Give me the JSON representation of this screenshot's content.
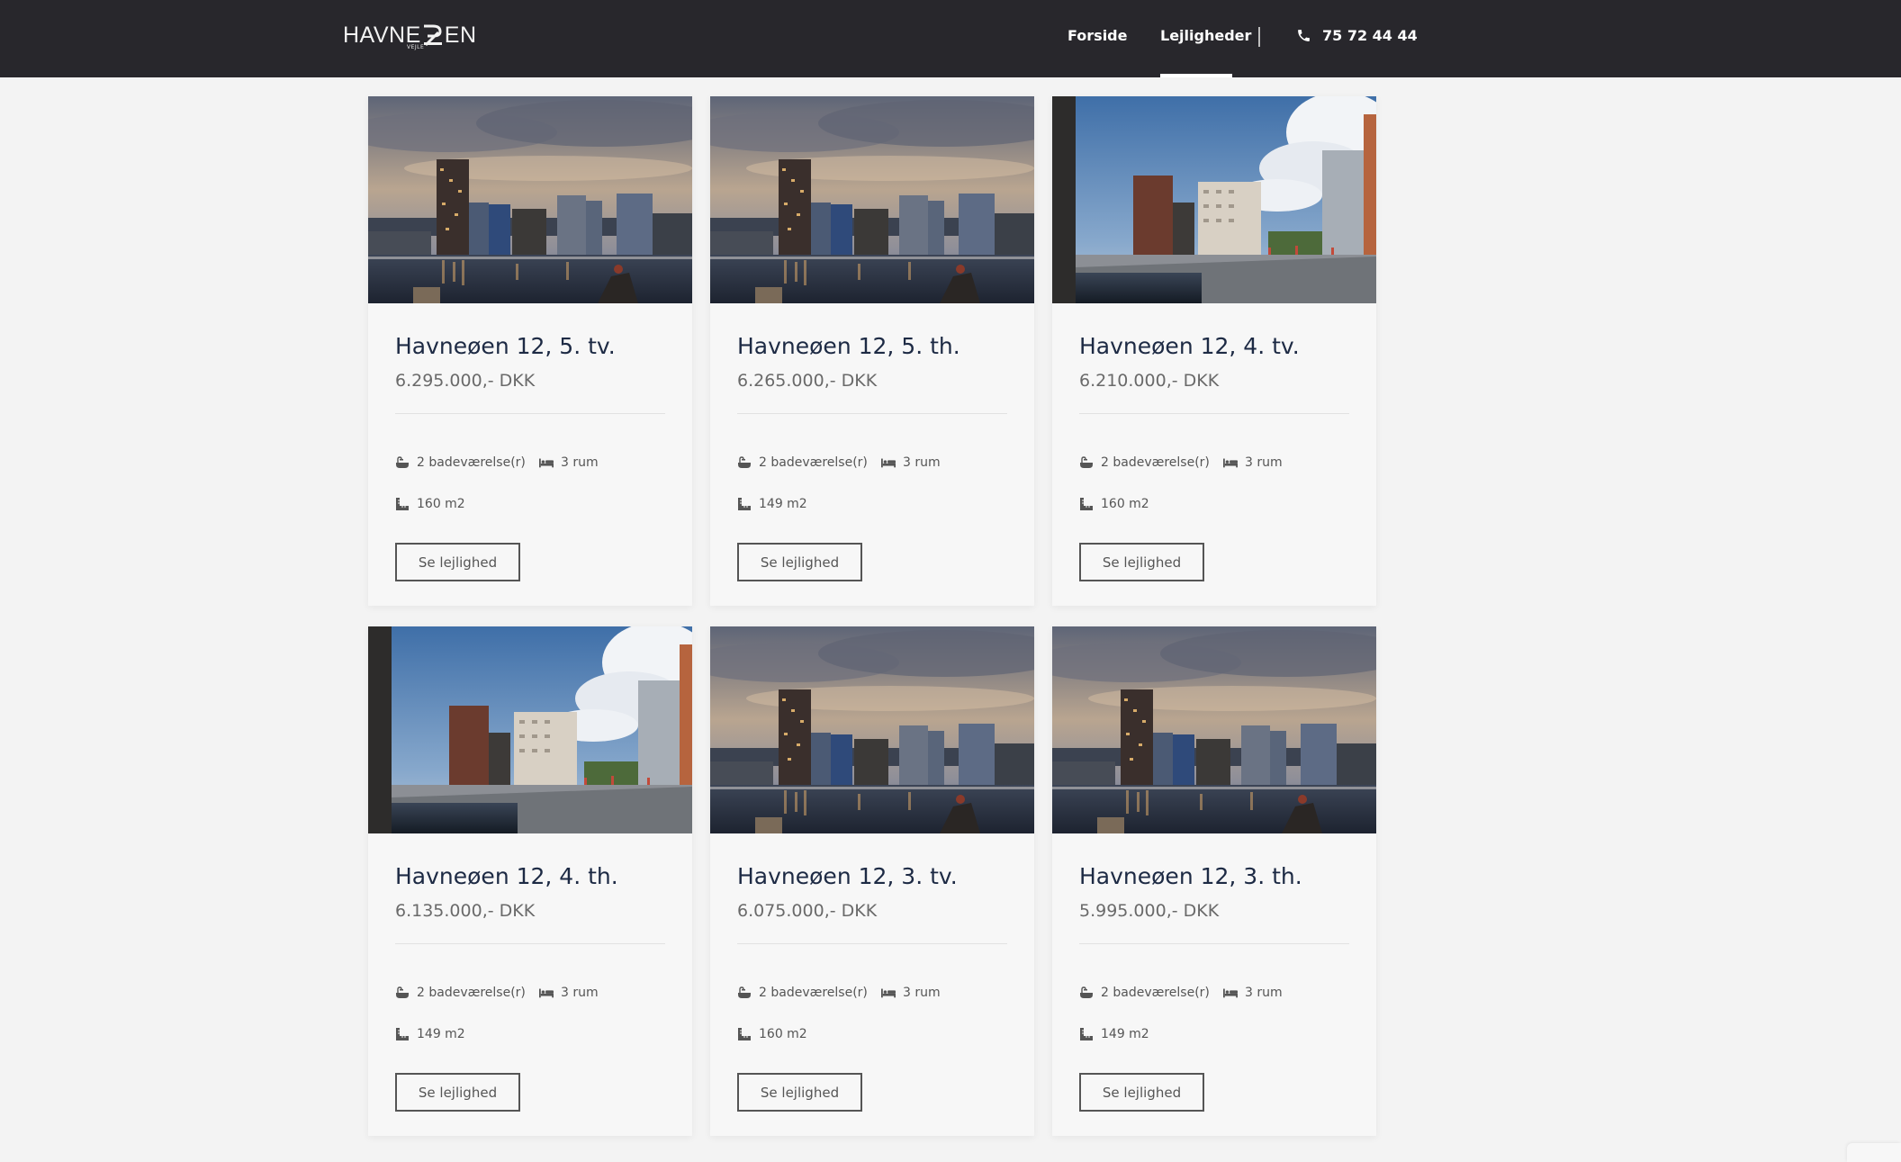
{
  "header": {
    "logo_text_left": "HAVNE",
    "logo_text_right": "EN",
    "logo_sub": "VEJLE",
    "nav": [
      {
        "label": "Forside",
        "active": false
      },
      {
        "label": "Lejligheder",
        "active": true
      }
    ],
    "phone": "75 72 44 44",
    "phone_icon": "phone-icon"
  },
  "colors": {
    "header_bg": "#28272c",
    "page_bg": "#f3f3f3",
    "card_bg": "#f7f7f7",
    "title": "#1d2a44",
    "text": "#555555"
  },
  "listings": [
    {
      "title": "Havneøen 12, 5. tv.",
      "price": "6.295.000,- DKK",
      "baths": "2 badeværelse(r)",
      "rooms": "3 rum",
      "area": "160 m2",
      "button": "Se lejlighed",
      "image": "dusk"
    },
    {
      "title": "Havneøen 12, 5. th.",
      "price": "6.265.000,- DKK",
      "baths": "2 badeværelse(r)",
      "rooms": "3 rum",
      "area": "149 m2",
      "button": "Se lejlighed",
      "image": "dusk"
    },
    {
      "title": "Havneøen 12, 4. tv.",
      "price": "6.210.000,- DKK",
      "baths": "2 badeværelse(r)",
      "rooms": "3 rum",
      "area": "160 m2",
      "button": "Se lejlighed",
      "image": "day"
    },
    {
      "title": "Havneøen 12, 4. th.",
      "price": "6.135.000,- DKK",
      "baths": "2 badeværelse(r)",
      "rooms": "3 rum",
      "area": "149 m2",
      "button": "Se lejlighed",
      "image": "day"
    },
    {
      "title": "Havneøen 12, 3. tv.",
      "price": "6.075.000,- DKK",
      "baths": "2 badeværelse(r)",
      "rooms": "3 rum",
      "area": "160 m2",
      "button": "Se lejlighed",
      "image": "dusk"
    },
    {
      "title": "Havneøen 12, 3. th.",
      "price": "5.995.000,- DKK",
      "baths": "2 badeværelse(r)",
      "rooms": "3 rum",
      "area": "149 m2",
      "button": "Se lejlighed",
      "image": "dusk"
    }
  ],
  "icons": {
    "baths": "bathtub-icon",
    "rooms": "bed-icon",
    "area": "ruler-icon"
  }
}
